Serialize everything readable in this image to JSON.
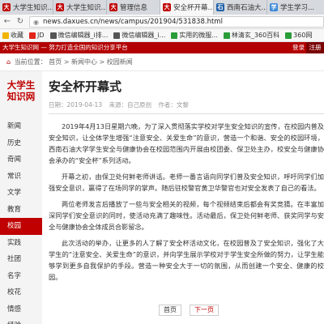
{
  "tabs": [
    {
      "label": "大学生知识...",
      "icon": "daxues-favicon",
      "active": false
    },
    {
      "label": "大学生知识...",
      "icon": "daxues-favicon",
      "active": false
    },
    {
      "label": "管理信息",
      "icon": "daxues-favicon",
      "active": false
    },
    {
      "label": "安全杯开幕...",
      "icon": "daxues-favicon",
      "active": true
    },
    {
      "label": "西南石油大...",
      "icon": "swpu-favicon",
      "active": false
    },
    {
      "label": "学生学习...",
      "icon": "app-favicon",
      "active": false
    }
  ],
  "address": {
    "url": "news.daxues.cn/news/campus/201904/531838.html"
  },
  "bookmarks": [
    "收藏",
    "JD",
    "微信编辑器_i排...",
    "微信编辑器_i...",
    "实用的微服...",
    "林清玄_360百科",
    "360网"
  ],
  "site_header": {
    "text": "大学生知识网 — 努力打造全国的知识分享平台",
    "register": "登录",
    "login": "注册"
  },
  "breadcrumb": {
    "prefix": "当前位置：",
    "home": "首页",
    "sep1": ">",
    "center": "新闻中心",
    "sep2": ">",
    "current": "校园新闻"
  },
  "logo": {
    "line1": "大学生",
    "line2": "知识网"
  },
  "nav": [
    "新闻",
    "历史",
    "奇闻",
    "常识",
    "文学",
    "教育",
    "校园",
    "实践",
    "社团",
    "名字",
    "校花",
    "情感",
    "经验"
  ],
  "nav_active_index": 6,
  "article": {
    "title": "安全杯开幕式",
    "date_label": "日期：2019-04-13",
    "source_label": "来源：自己原创",
    "author_label": "作者：文黎",
    "paragraphs": [
      "2019年4月13日星期六晚，为了深入贯彻落实学校对学生安全知识的宣传，在校园内普及安全知识，让全体学生增强“注意安全、关爱生命”的意识，营造一个和谐、安全的校园环境，西南石油大学学生安全与健康协会在校园范围内开展由校团委、保卫处主办，校安全与健康协会承办的“安全杯”系列活动。",
      "开幕之初，由保卫处何鲜老师讲话。老师一番言语向同学们普及安全知识，呼吁同学们加强安全意识，赢得了在场同学的掌声。随后驻校警官黄卫华警官也对安全发表了自己的看法。",
      "两位老师发言后播放了一些与安全相关的视频，每个视频结束后都会有奖竞猜。在丰富加深同学们安全意识的同时，使活动充满了趣味性。活动最后，保卫处何鲜老师、获奖同学与安全与健康协会全体成员合影留念。",
      "此次活动的举办，让更多的人了解了安全杯活动文化，在校园普及了安全知识，强化了大学生的“注意安全、关爱生命”的意识，并向学生展示学校对于学生安全所做的努力，让学生能够学到更多自我保护的手段。营造一种安全大于一切的氛围，从而创建一个安全、健康的校园。"
    ]
  },
  "pager": {
    "first": "首页",
    "next": "下一页"
  },
  "colors": {
    "brand": "#c00000",
    "header": "#b30000"
  }
}
